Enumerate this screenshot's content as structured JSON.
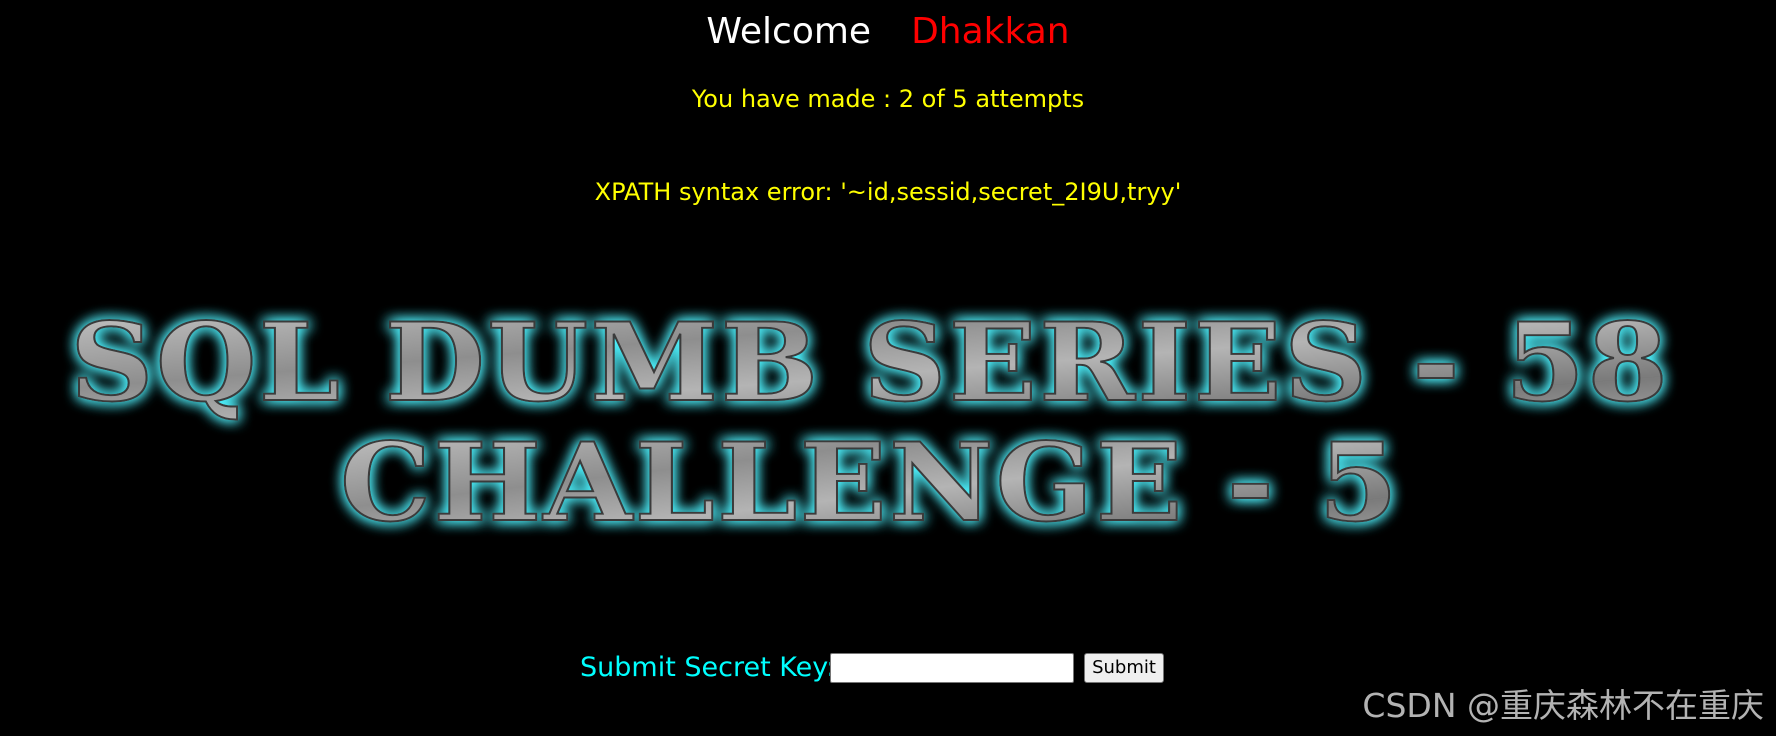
{
  "header": {
    "welcome_label": "Welcome",
    "user_name": "Dhakkan"
  },
  "status": {
    "attempts_text": "You have made : 2 of 5 attempts",
    "error_text": "XPATH syntax error: '~id,sessid,secret_2I9U,tryy'"
  },
  "banner": {
    "line1": "SQL DUMB SERIES - 58",
    "line2": "CHALLENGE - 5"
  },
  "form": {
    "label": "Submit Secret Key:",
    "input_value": "",
    "submit_label": "Submit"
  },
  "watermark": {
    "text": "CSDN @重庆森林不在重庆"
  },
  "colors": {
    "background": "#000000",
    "welcome": "#ffffff",
    "user_name": "#ff0000",
    "status_text": "#ffff00",
    "form_label": "#00ffff",
    "banner_glow": "#4ff3ff",
    "banner_metal": "#9a9a9a"
  }
}
